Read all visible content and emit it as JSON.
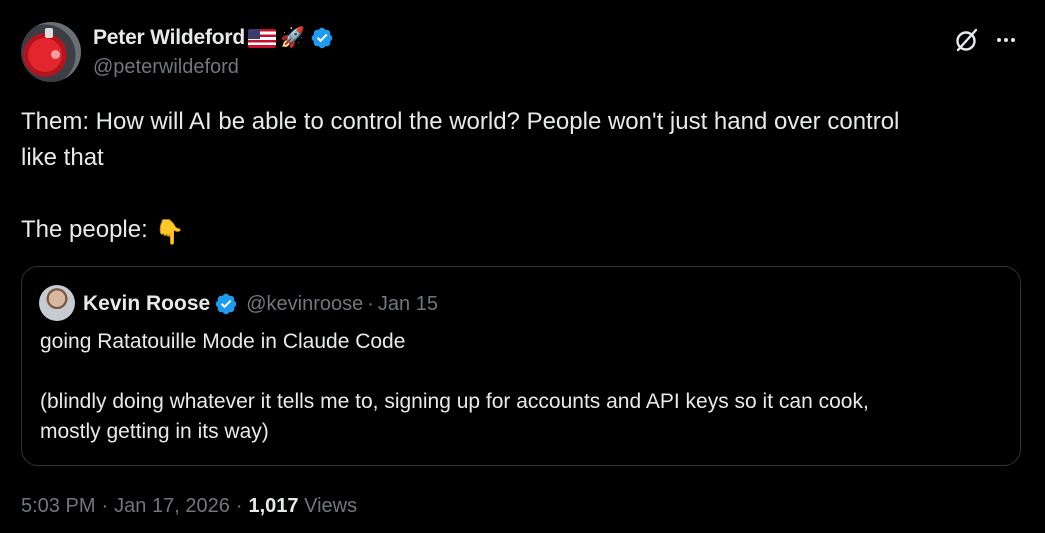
{
  "author": {
    "display_name": "Peter Wildeford",
    "handle": "@peterwildeford",
    "verified_color": "#1d9bf0"
  },
  "icons": {
    "flag": "us-flag-icon",
    "rocket": "rocket-icon",
    "rocket_glyph": "🚀",
    "pointing": "backhand-index-pointing-down-icon",
    "pointing_glyph": "👇",
    "grok": "grok-icon",
    "more": "more-icon"
  },
  "tweet": {
    "lines": [
      "Them: How will AI be able to control the world? People won't just hand over control",
      "like that",
      "",
      "The people: "
    ]
  },
  "quote": {
    "display_name": "Kevin Roose",
    "handle": "@kevinroose",
    "separator": "·",
    "date": "Jan 15",
    "lines": [
      "going Ratatouille Mode in Claude Code",
      "",
      "(blindly doing whatever it tells me to, signing up for accounts and API keys so it can cook,",
      "mostly getting in its way)"
    ]
  },
  "meta": {
    "time": "5:03 PM",
    "separator": "·",
    "date": "Jan 17, 2026",
    "views_count": "1,017",
    "views_label": "Views"
  },
  "colors": {
    "background": "#000000",
    "text": "#e7e9ea",
    "muted": "#71767b",
    "border": "#2f3336",
    "verified": "#1d9bf0"
  }
}
